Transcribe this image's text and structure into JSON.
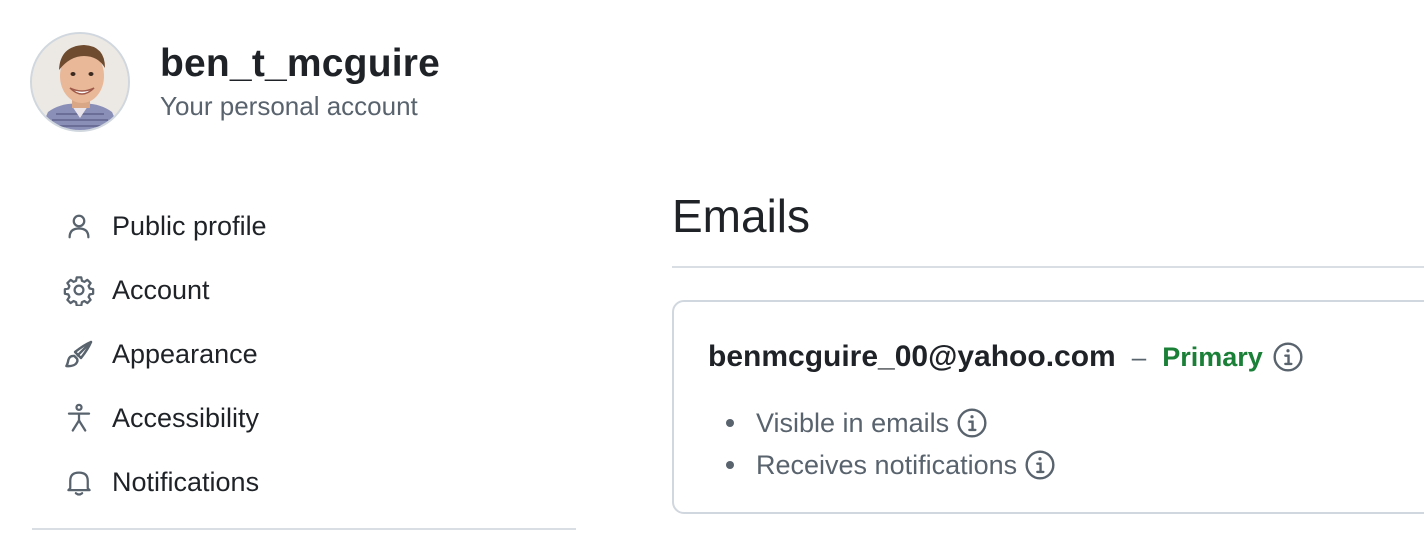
{
  "header": {
    "username": "ben_t_mcguire",
    "subtitle": "Your personal account"
  },
  "sidebar": {
    "items": [
      {
        "label": "Public profile",
        "icon": "person-icon"
      },
      {
        "label": "Account",
        "icon": "gear-icon"
      },
      {
        "label": "Appearance",
        "icon": "paintbrush-icon"
      },
      {
        "label": "Accessibility",
        "icon": "accessibility-icon"
      },
      {
        "label": "Notifications",
        "icon": "bell-icon"
      }
    ]
  },
  "main": {
    "title": "Emails",
    "email": {
      "address": "benmcguire_00@yahoo.com",
      "separator": "–",
      "primary_label": "Primary",
      "details": [
        {
          "text": "Visible in emails",
          "icon": "info-icon"
        },
        {
          "text": "Receives notifications",
          "icon": "info-icon"
        }
      ]
    }
  },
  "colors": {
    "text_primary": "#1f2328",
    "text_muted": "#59636e",
    "primary_green": "#1a7f37",
    "border": "#d0d7de"
  }
}
